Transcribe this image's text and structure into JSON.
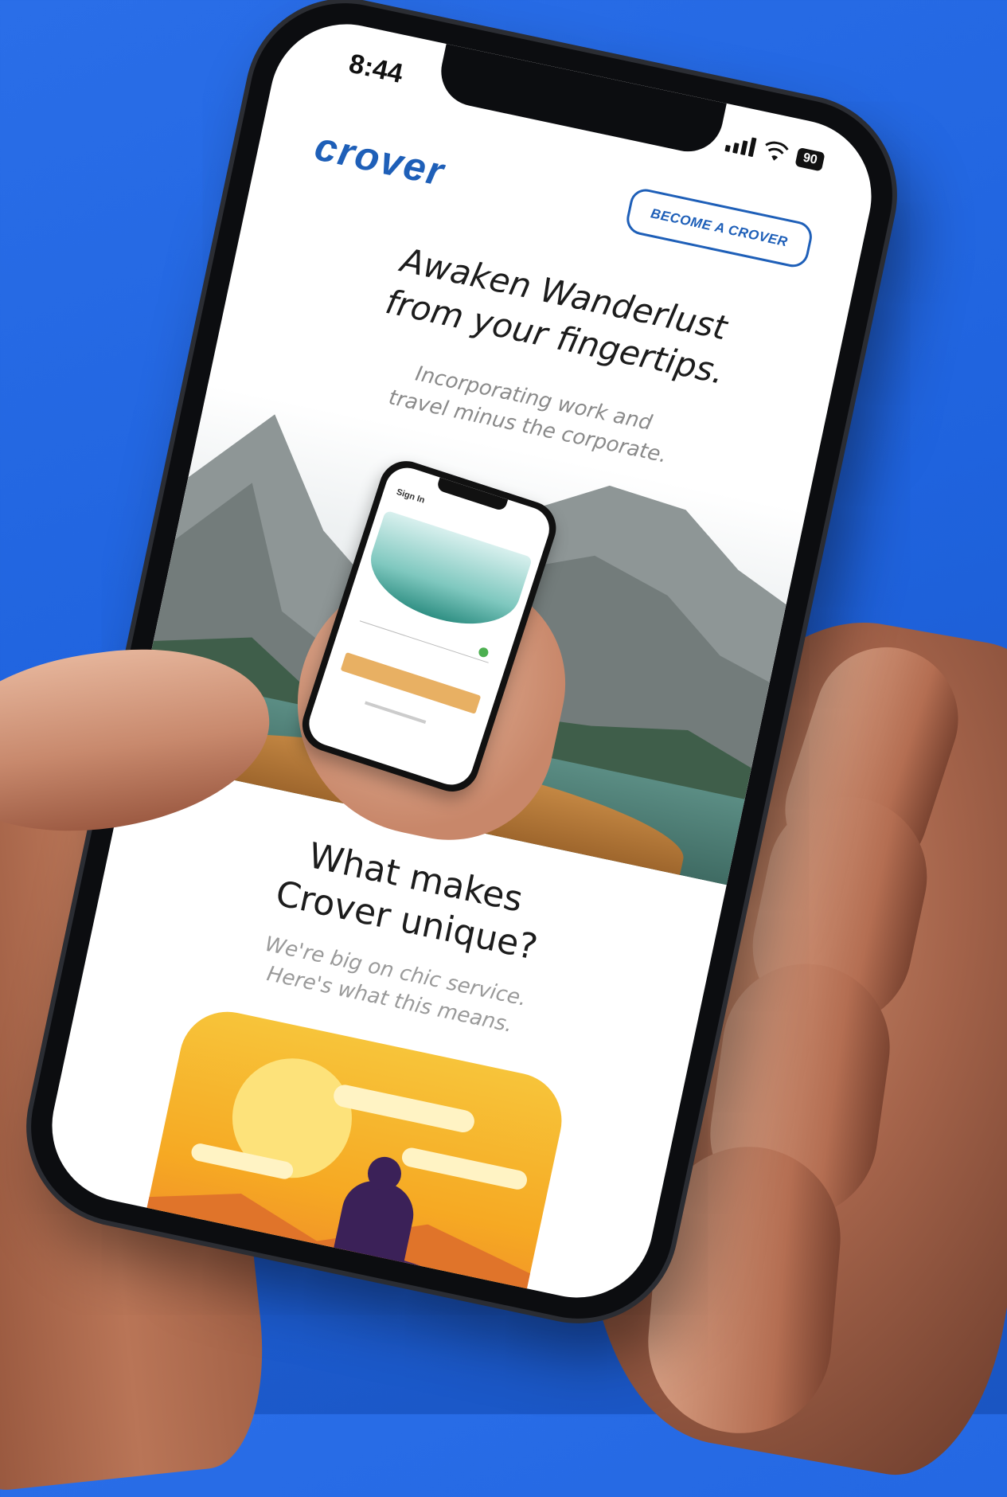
{
  "status_bar": {
    "time": "8:44",
    "battery": "90"
  },
  "header": {
    "logo": "crover",
    "cta_label": "BECOME A CROVER"
  },
  "hero": {
    "title_line1": "Awaken Wanderlust",
    "title_line2": "from your fingertips.",
    "subtitle_line1": "Incorporating work and",
    "subtitle_line2": "travel minus the corporate."
  },
  "inner_phone": {
    "screen_title": "Sign In"
  },
  "features": {
    "title_line1": "What makes",
    "title_line2": "Crover unique?",
    "subtitle_line1": "We're big on chic service.",
    "subtitle_line2": "Here's what this means."
  },
  "colors": {
    "background": "#2266e0",
    "brand": "#1e5fb8",
    "accent": "#e8b063"
  },
  "icons": [
    "signal-icon",
    "wifi-icon",
    "battery-icon"
  ]
}
